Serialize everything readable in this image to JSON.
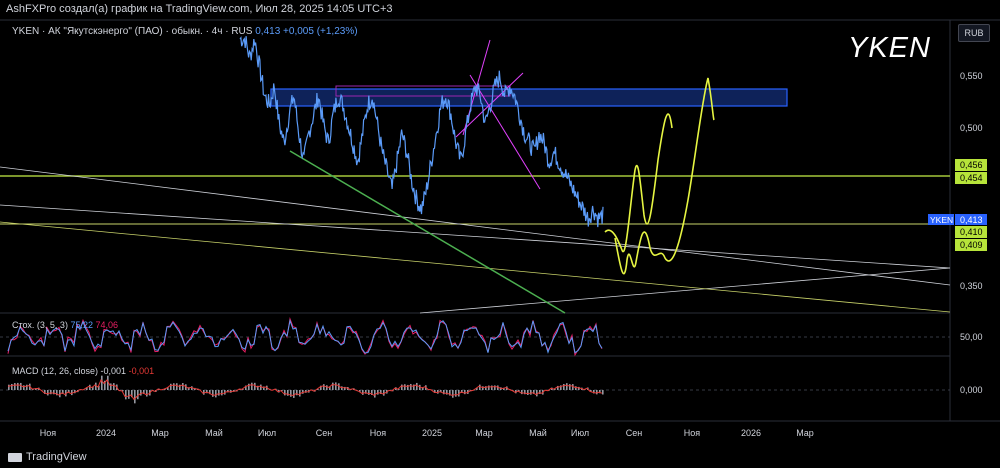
{
  "header": {
    "title": "AshFXPro создал(а) график на TradingView.com, Июл 28, 2025 14:05 UTC+3"
  },
  "legend": {
    "text": "YKEN · АК \"Якутскэнерго\" (ПАО) · обыкн. · 4ч · RUS",
    "last": "0,413",
    "change": "+0,005 (+1,23%)"
  },
  "big_ticker": "YKEN",
  "currency": "RUB",
  "stoch": {
    "label": "Стох. (3, 5, 3)",
    "k": "75,22",
    "d": "74,06"
  },
  "macd": {
    "label": "MACD (12, 26, close)",
    "v1": "-0,001",
    "v2": "-0,001"
  },
  "footer": {
    "brand": "TradingView"
  },
  "chart_data": {
    "type": "line",
    "symbol": "YKEN",
    "timeframe": "4ч",
    "y_ticks": [
      "0,550",
      "0,500",
      "0,350"
    ],
    "price_tags": [
      "0,456",
      "0,454",
      "0,410",
      "0,409"
    ],
    "last_tag": {
      "label": "YKEN",
      "value": "0,413"
    },
    "ylim": [
      0.31,
      0.62
    ],
    "stoch_tick": "50,00",
    "macd_tick": "0,000",
    "x_ticks": [
      "Ноя",
      "2024",
      "Мар",
      "Май",
      "Июл",
      "Сен",
      "Ноя",
      "2025",
      "Мар",
      "Май",
      "Июл",
      "Сен",
      "Ноя",
      "2026",
      "Мар"
    ],
    "series": [
      {
        "values": [
          0.6,
          0.6,
          0.58,
          0.6,
          0.57,
          0.54,
          0.53,
          0.55,
          0.51,
          0.49,
          0.52,
          0.54,
          0.5,
          0.47,
          0.5,
          0.52,
          0.54,
          0.51,
          0.49,
          0.52,
          0.54,
          0.53,
          0.51,
          0.49,
          0.47,
          0.5,
          0.53,
          0.54,
          0.51,
          0.48,
          0.46,
          0.44,
          0.47,
          0.5,
          0.48,
          0.45,
          0.43,
          0.42,
          0.44,
          0.47,
          0.5,
          0.53,
          0.54,
          0.52,
          0.49,
          0.47,
          0.5,
          0.53,
          0.55,
          0.54,
          0.51,
          0.53,
          0.55,
          0.56,
          0.54,
          0.55,
          0.54,
          0.52,
          0.5,
          0.49,
          0.48,
          0.5,
          0.49,
          0.47,
          0.48,
          0.47,
          0.46,
          0.45,
          0.44,
          0.43,
          0.42,
          0.41,
          0.42,
          0.41,
          0.413
        ]
      }
    ],
    "colors": {
      "price": "#5b9bf8",
      "zone": "#2962ff",
      "forecast": "#e6f542",
      "trendline": "#4caf50",
      "stoch_k": "#5b9bf8",
      "stoch_d": "#e91e63",
      "macd_line": "#e53935"
    }
  }
}
